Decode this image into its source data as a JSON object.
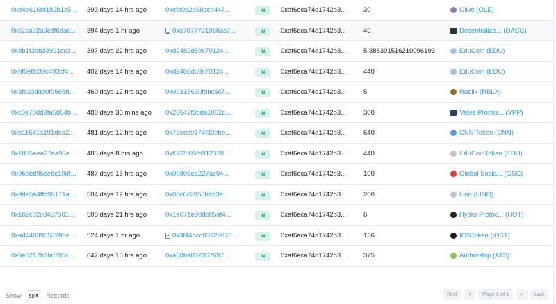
{
  "rows": [
    {
      "hash": "0xd4b616bf182b1c5...",
      "age": "393 days 14 hrs ago",
      "from": "0xefc0d2d68ceb447...",
      "from_contract": false,
      "dir": "IN",
      "to": "0xaf6eca74d1742b3...",
      "qty": "30",
      "token": "Olive (OLE)",
      "icon": "olive-token-icon",
      "icon_color": "#8e7cc3"
    },
    {
      "hash": "0xc2aa02a9c8f6dac...",
      "age": "394 days 1 hr ago",
      "from": "0xa7077721086ac7...",
      "from_contract": true,
      "dir": "IN",
      "to": "0xaf6eca74d1742b3...",
      "qty": "40",
      "token": "Decentralize... (DACC)",
      "icon": "dacc-token-icon",
      "icon_color": "#333333"
    },
    {
      "hash": "0x8b1f3bb33921cc3...",
      "age": "397 days 22 hrs ago",
      "from": "0xd2482d59c70124...",
      "from_contract": false,
      "dir": "IN",
      "to": "0xaf6eca74d1742b3...",
      "qty": "5.388391516210096193",
      "token": "EduCoin (EDU)",
      "icon": "educoin-token-icon",
      "icon_color": "#9ec3e6"
    },
    {
      "hash": "0x9f6e8c39c493cf4...",
      "age": "402 days 14 hrs ago",
      "from": "0xd2482d59c70124...",
      "from_contract": false,
      "dir": "IN",
      "to": "0xaf6eca74d1742b3...",
      "qty": "440",
      "token": "EduCoin (EDU)",
      "icon": "educoin-token-icon",
      "icon_color": "#9ec3e6"
    },
    {
      "hash": "0x3fc23dad0f95e5b...",
      "age": "460 days 12 hrs ago",
      "from": "0x00315630fdbc5c7...",
      "from_contract": false,
      "dir": "IN",
      "to": "0xaf6eca74d1742b3...",
      "qty": "5",
      "token": "Rublix (RBLX)",
      "icon": "rublix-token-icon",
      "icon_color": "#8a6d1f"
    },
    {
      "hash": "0xc0a78dd9fa5b54b...",
      "age": "480 days 36 mins ago",
      "from": "0x29642f3dda1062c...",
      "from_contract": false,
      "dir": "IN",
      "to": "0xaf6eca74d1742b3...",
      "qty": "300",
      "token": "Value Promis... (VPP)",
      "icon": "vpp-token-icon",
      "icon_color": "#2c3e66"
    },
    {
      "hash": "0xb11641a191dea2...",
      "age": "481 days 12 hrs ago",
      "from": "0x73edc9174f30ebb...",
      "from_contract": false,
      "dir": "IN",
      "to": "0xaf6eca74d1742b3...",
      "qty": "640",
      "token": "CNN Token (CNN)",
      "icon": "cnn-token-icon",
      "icon_color": "#5b9bd5"
    },
    {
      "hash": "0x1885aea27ea93e...",
      "age": "485 days 8 hrs ago",
      "from": "0xf582805fb912378...",
      "from_contract": false,
      "dir": "IN",
      "to": "0xaf6eca74d1742b3...",
      "qty": "440",
      "token": "EduCoinToken (EDU)",
      "icon": "educointoken-icon",
      "icon_color": "#c0c4c9"
    },
    {
      "hash": "0x95bbd95ce8c10df...",
      "age": "487 days 16 hrs ago",
      "from": "0x00805ea227ac94...",
      "from_contract": false,
      "dir": "IN",
      "to": "0xaf6eca74d1742b3...",
      "qty": "100",
      "token": "Global Socia... (GSC)",
      "icon": "gsc-token-icon",
      "icon_color": "#e53935"
    },
    {
      "hash": "0xdde5a4ffb99171a...",
      "age": "504 days 12 hrs ago",
      "from": "0x08c6c2956bbb3e...",
      "from_contract": false,
      "dir": "IN",
      "to": "0xaf6eca74d1742b3...",
      "qty": "200",
      "token": "Lino (LINO)",
      "icon": "lino-token-icon",
      "icon_color": "#c0c4c9"
    },
    {
      "hash": "0x162c02c8457561...",
      "age": "508 days 21 hrs ago",
      "from": "0x1a671e90db05af4...",
      "from_contract": false,
      "dir": "IN",
      "to": "0xaf6eca74d1742b3...",
      "qty": "6",
      "token": "Hydro Protoc... (HOT)",
      "icon": "hydro-token-icon",
      "icon_color": "#222222"
    },
    {
      "hash": "0xad4403905328be...",
      "age": "524 days 1 hr ago",
      "from": "0x3f44bcc03229678...",
      "from_contract": true,
      "dir": "IN",
      "to": "0xaf6eca74d1742b3...",
      "qty": "136",
      "token": "IOSToken (IOST)",
      "icon": "iost-token-icon",
      "icon_color": "#1a1a1a"
    },
    {
      "hash": "0x9e8217b3bc795c...",
      "age": "647 days 15 hrs ago",
      "from": "0xa68ba002367697...",
      "from_contract": false,
      "dir": "IN",
      "to": "0xaf6eca74d1742b3...",
      "qty": "375",
      "token": "Authorship (ATS)",
      "icon": "authorship-token-icon",
      "icon_color": "#8bc34a"
    }
  ],
  "footer": {
    "show_label": "Show",
    "page_size": "50",
    "records_label": "Records",
    "first": "First",
    "prev": "<",
    "page_info": "Page 1 of 1",
    "next": ">",
    "last": "Last"
  },
  "colors": {
    "link": "#3498db",
    "badge_bg": "#d6f2ea",
    "badge_text": "#00a186"
  }
}
